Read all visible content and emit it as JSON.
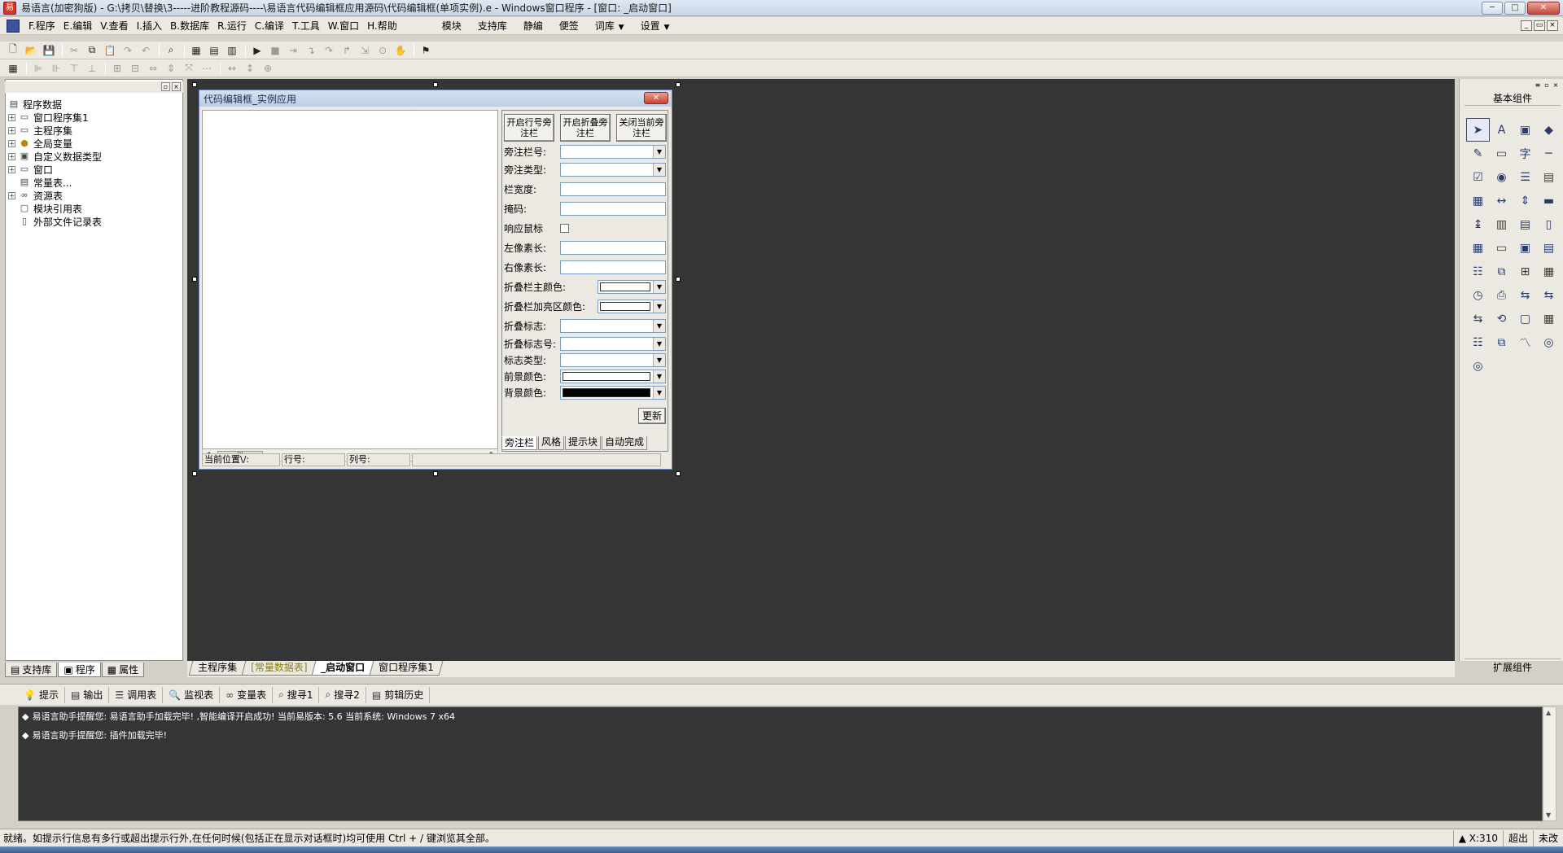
{
  "window": {
    "title": "易语言(加密狗版) - G:\\拷贝\\替换\\3-----进阶教程源码----\\易语言代码编辑框应用源码\\代码编辑框(单项实例).e - Windows窗口程序 - [窗口: _启动窗口]",
    "btn_min": "─",
    "btn_max": "□",
    "btn_close": "✕"
  },
  "menu": {
    "items": [
      {
        "key": "F",
        "label": "F.程序"
      },
      {
        "key": "E",
        "label": "E.编辑"
      },
      {
        "key": "V",
        "label": "V.查看"
      },
      {
        "key": "I",
        "label": "I.插入"
      },
      {
        "key": "B",
        "label": "B.数据库"
      },
      {
        "key": "R",
        "label": "R.运行"
      },
      {
        "key": "C",
        "label": "C.编译"
      },
      {
        "key": "T",
        "label": "T.工具"
      },
      {
        "key": "W",
        "label": "W.窗口"
      },
      {
        "key": "H",
        "label": "H.帮助"
      }
    ],
    "extra": [
      "模块",
      "支持库",
      "静编",
      "便签",
      "词库",
      "设置"
    ]
  },
  "tree": {
    "root": "程序数据",
    "items": [
      {
        "label": "窗口程序集1",
        "icon": "folder-icon",
        "expand": "+"
      },
      {
        "label": "主程序集",
        "icon": "folder-icon",
        "expand": "+"
      },
      {
        "label": "全局变量",
        "icon": "variable-icon",
        "expand": "+"
      },
      {
        "label": "自定义数据类型",
        "icon": "type-icon",
        "expand": "+"
      },
      {
        "label": "窗口",
        "icon": "window-icon",
        "expand": "+"
      },
      {
        "label": "常量表...",
        "icon": "const-icon",
        "expand": ""
      },
      {
        "label": "资源表",
        "icon": "resource-icon",
        "expand": "+"
      },
      {
        "label": "模块引用表",
        "icon": "module-icon",
        "expand": ""
      },
      {
        "label": "外部文件记录表",
        "icon": "file-icon",
        "expand": ""
      }
    ]
  },
  "left_tabs": [
    "支持库",
    "程序",
    "属性"
  ],
  "form": {
    "title": "代码编辑框_实例应用",
    "close_label": "✕",
    "buttons": [
      "开启行号旁注栏",
      "开启折叠旁注栏",
      "关闭当前旁注栏"
    ],
    "props": [
      {
        "label": "旁注栏号:",
        "type": "combo"
      },
      {
        "label": "旁注类型:",
        "type": "combo"
      },
      {
        "label": "栏宽度:",
        "type": "text"
      },
      {
        "label": "掩码:",
        "type": "text"
      },
      {
        "label": "响应鼠标",
        "type": "check"
      },
      {
        "label": "左像素长:",
        "type": "text"
      },
      {
        "label": "右像素长:",
        "type": "text"
      },
      {
        "label": "折叠栏主颜色:",
        "type": "color",
        "color": "#ffffff"
      },
      {
        "label": "折叠栏加亮区颜色:",
        "type": "color",
        "color": "#ffffff"
      },
      {
        "label": "折叠标志:",
        "type": "combo"
      },
      {
        "label": "折叠标志号:",
        "type": "combo"
      },
      {
        "label": "标志类型:",
        "type": "combo"
      },
      {
        "label": "前景颜色:",
        "type": "color",
        "color": "#ffffff"
      },
      {
        "label": "背景颜色:",
        "type": "color",
        "color": "#000000"
      }
    ],
    "refresh_label": "更新",
    "side_tabs": [
      "旁注栏",
      "风格",
      "提示块",
      "自动完成"
    ],
    "status": {
      "pos": "当前位置\\/:",
      "line": "行号:",
      "col": "列号:"
    },
    "scroll_thumb": "III"
  },
  "components": {
    "header": "基本组件",
    "footer": "扩展组件",
    "icons": [
      "pointer-icon",
      "label-icon",
      "picture-icon",
      "shape-icon",
      "edit-icon",
      "frame-icon",
      "char-icon",
      "line-icon",
      "checkbox-icon",
      "radio-icon",
      "listbox-icon",
      "combobox-icon",
      "grid-icon",
      "ruler-icon",
      "scrollbar-icon",
      "progress-icon",
      "slider-icon",
      "tab-icon",
      "panel-icon",
      "doc-icon",
      "table-icon",
      "status-icon",
      "gif-icon",
      "note-icon",
      "tree-icon",
      "network-icon",
      "split-icon",
      "calendar-icon",
      "timer-icon",
      "printer-icon",
      "server-icon",
      "client-icon",
      "port-icon",
      "hook-icon",
      "layout-icon",
      "frame2-icon",
      "db-icon",
      "db2-icon",
      "chart-icon",
      "odbc-icon",
      "odbc2-icon"
    ],
    "glyphs": [
      "➤",
      "A",
      "▣",
      "◆",
      "✎",
      "▭",
      "字",
      "─",
      "☑",
      "◉",
      "☰",
      "▤",
      "▦",
      "↔",
      "⇕",
      "▬",
      "↨",
      "▥",
      "▤",
      "▯",
      "▦",
      "▭",
      "▣",
      "▤",
      "☷",
      "⧉",
      "⊞",
      "▦",
      "◷",
      "⎙",
      "⇆",
      "⇆",
      "⇆",
      "⟲",
      "▢",
      "▦",
      "☷",
      "⧉",
      "〽",
      "◎",
      "◎"
    ]
  },
  "doc_tabs": [
    {
      "label": "主程序集",
      "state": "normal"
    },
    {
      "label": "[常量数据表]",
      "state": "olive"
    },
    {
      "label": "_启动窗口",
      "state": "active"
    },
    {
      "label": "窗口程序集1",
      "state": "normal"
    }
  ],
  "output": {
    "tabs": [
      {
        "label": "提示",
        "icon": "tip-icon",
        "glyph": "💡"
      },
      {
        "label": "输出",
        "icon": "output-icon",
        "glyph": "▤"
      },
      {
        "label": "调用表",
        "icon": "callstack-icon",
        "glyph": "☰"
      },
      {
        "label": "监视表",
        "icon": "watch-icon",
        "glyph": "🔍"
      },
      {
        "label": "变量表",
        "icon": "variables-icon",
        "glyph": "∞"
      },
      {
        "label": "搜寻1",
        "icon": "search1-icon",
        "glyph": "⌕"
      },
      {
        "label": "搜寻2",
        "icon": "search2-icon",
        "glyph": "⌕"
      },
      {
        "label": "剪辑历史",
        "icon": "clipboard-icon",
        "glyph": "▤"
      }
    ],
    "lines": [
      "易语言助手提醒您: 易语言助手加载完毕! ,智能编译开启成功! 当前易版本: 5.6 当前系统: Windows 7 x64",
      "易语言助手提醒您: 插件加载完毕!"
    ]
  },
  "statusbar": {
    "message": "就绪。如提示行信息有多行或超出提示行外,在任何时候(包括正在显示对话框时)均可使用 Ctrl + / 键浏览其全部。",
    "coord": "X:310",
    "mode": "超出",
    "state": "未改"
  }
}
